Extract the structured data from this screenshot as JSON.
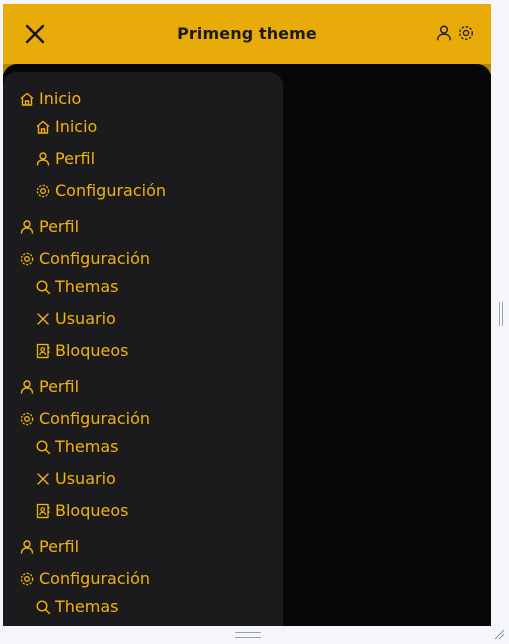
{
  "header": {
    "title": "Primeng theme",
    "close_icon": "close-icon",
    "user_icon": "user-icon",
    "settings_icon": "gear-icon"
  },
  "colors": {
    "accent": "#e9ab0a",
    "menu_text": "#f2b30a",
    "sidebar_bg": "#1b1b1d",
    "content_bg": "#070707"
  },
  "menu": [
    {
      "label": "Inicio",
      "icon": "home-icon",
      "level": 0
    },
    {
      "label": "Inicio",
      "icon": "home-icon",
      "level": 1
    },
    {
      "label": "Perfil",
      "icon": "user-icon",
      "level": 1
    },
    {
      "label": "Configuración",
      "icon": "gear-icon",
      "level": 1
    },
    {
      "label": "Perfil",
      "icon": "user-icon",
      "level": 0
    },
    {
      "label": "Configuración",
      "icon": "gear-icon",
      "level": 0
    },
    {
      "label": "Themas",
      "icon": "search-icon",
      "level": 1
    },
    {
      "label": "Usuario",
      "icon": "close-icon",
      "level": 1
    },
    {
      "label": "Bloqueos",
      "icon": "address-book-icon",
      "level": 1
    },
    {
      "label": "Perfil",
      "icon": "user-icon",
      "level": 0
    },
    {
      "label": "Configuración",
      "icon": "gear-icon",
      "level": 0
    },
    {
      "label": "Themas",
      "icon": "search-icon",
      "level": 1
    },
    {
      "label": "Usuario",
      "icon": "close-icon",
      "level": 1
    },
    {
      "label": "Bloqueos",
      "icon": "address-book-icon",
      "level": 1
    },
    {
      "label": "Perfil",
      "icon": "user-icon",
      "level": 0
    },
    {
      "label": "Configuración",
      "icon": "gear-icon",
      "level": 0
    },
    {
      "label": "Themas",
      "icon": "search-icon",
      "level": 1
    }
  ]
}
